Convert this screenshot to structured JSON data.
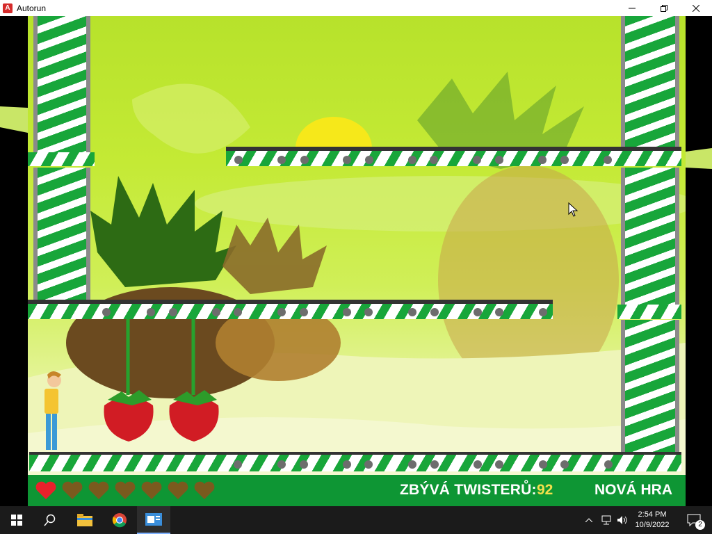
{
  "window": {
    "title": "Autorun",
    "minimize_icon": "minimize-icon",
    "maximize_icon": "restore-icon",
    "close_icon": "close-icon"
  },
  "hud": {
    "lives_total": 7,
    "lives_remaining": 1,
    "twisters_label": "ZBÝVÁ TWISTERŮ:",
    "twisters_count": "92",
    "new_game_label": "NOVÁ HRA"
  },
  "colors": {
    "hud_bg": "#0e9634",
    "count_color": "#f3e04c",
    "heart_full": "#e8212b",
    "heart_empty": "#7a5a1e"
  },
  "taskbar": {
    "clock_time": "2:54 PM",
    "clock_date": "10/9/2022",
    "notification_count": "2",
    "icons": [
      "windows-start-icon",
      "search-icon",
      "file-explorer-icon",
      "chrome-icon",
      "autorun-app-icon"
    ]
  }
}
